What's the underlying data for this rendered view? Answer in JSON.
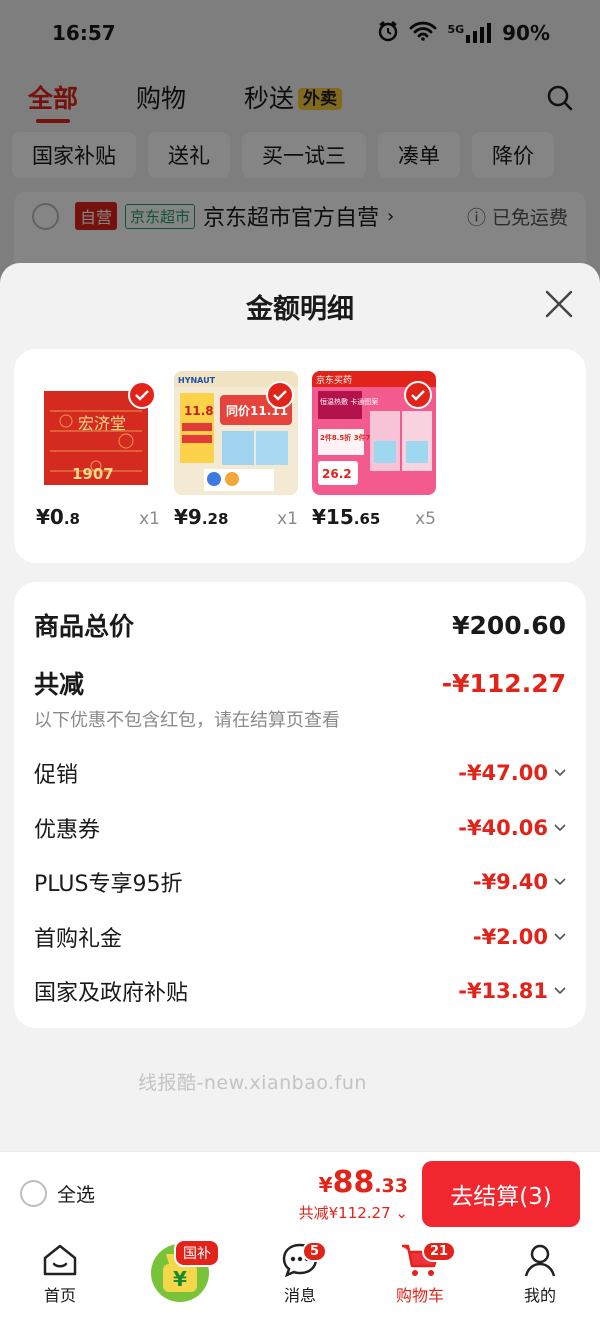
{
  "status_bar": {
    "time": "16:57",
    "battery": "90%",
    "network": "5G"
  },
  "top_tabs": [
    {
      "label": "全部"
    },
    {
      "label": "购物"
    },
    {
      "label": "秒送"
    }
  ],
  "waimai_badge": "外卖",
  "chips": [
    "国家补贴",
    "送礼",
    "买一试三",
    "凑单",
    "降价"
  ],
  "store": {
    "self_tag": "自营",
    "market_tag": "京东超市",
    "name": "京东超市官方自营",
    "free_shipping": "已免运费"
  },
  "sheet": {
    "title": "金额明细",
    "products": [
      {
        "price_int": "¥0",
        "price_dec": ".8",
        "qty": "x1",
        "thumb": "红色礼盒"
      },
      {
        "price_int": "¥9",
        "price_dec": ".28",
        "qty": "x1",
        "thumb": "海氏海诺消毒湿巾"
      },
      {
        "price_int": "¥15",
        "price_dec": ".65",
        "qty": "x5",
        "thumb": "京东买药 卡通图案"
      }
    ],
    "product_images": {
      "p1_text": "宏济堂",
      "p1_year": "1907",
      "p2_brand": "HYNAUT",
      "p2_price": "11.8",
      "p2_promo": "同价11.11",
      "p3_shop": "京东买药",
      "p3_promo": "恒温热敷 卡通图案",
      "p3_discount": "2件8.5折 3件7.5折",
      "p3_price": "26.2"
    },
    "total_label": "商品总价",
    "total_value": "¥200.60",
    "reduce_label": "共减",
    "reduce_value": "-¥112.27",
    "note": "以下优惠不包含红包，请在结算页查看",
    "discounts": [
      {
        "label": "促销",
        "value": "-¥47.00"
      },
      {
        "label": "优惠券",
        "value": "-¥40.06"
      },
      {
        "label": "PLUS专享95折",
        "value": "-¥9.40"
      },
      {
        "label": "首购礼金",
        "value": "-¥2.00"
      },
      {
        "label": "国家及政府补贴",
        "value": "-¥13.81"
      }
    ]
  },
  "watermark": "线报酷-new.xianbao.fun",
  "checkout": {
    "select_all": "全选",
    "currency": "¥",
    "amount_int": "88",
    "amount_dec": ".33",
    "saved": "共减¥112.27",
    "pay_button": "去结算(3)"
  },
  "tabbar": [
    {
      "label": "首页"
    },
    {
      "label": "",
      "badge": "国补"
    },
    {
      "label": "消息",
      "badge": "5"
    },
    {
      "label": "购物车",
      "badge": "21"
    },
    {
      "label": "我的"
    }
  ],
  "colors": {
    "accent": "#e2231a",
    "background": "#f2f2f2"
  }
}
